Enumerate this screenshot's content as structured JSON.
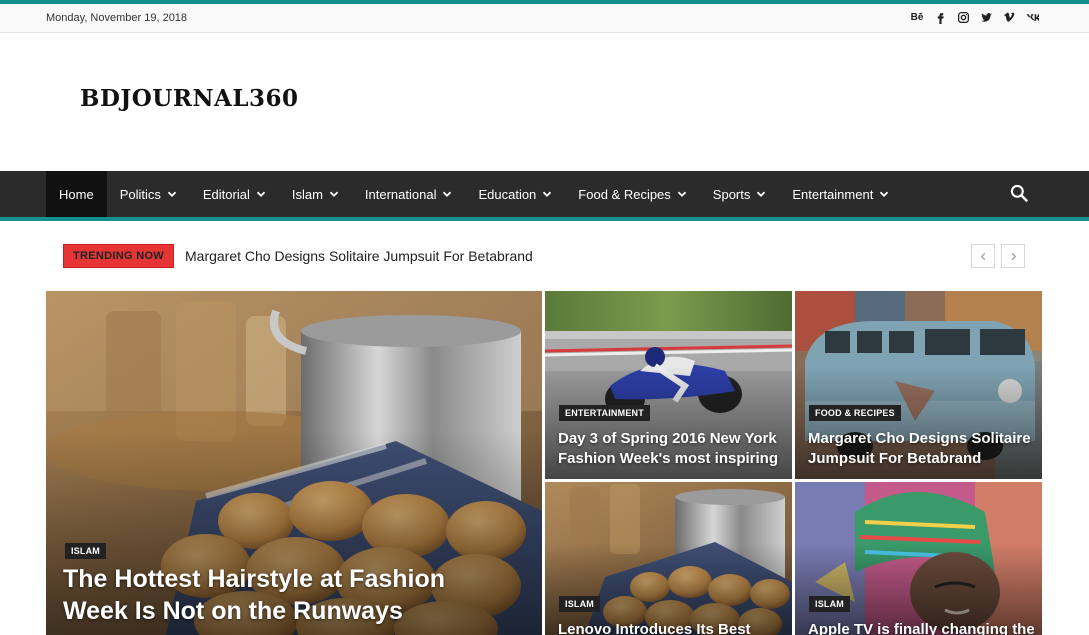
{
  "topbar": {
    "date": "Monday, November 19, 2018",
    "socials": [
      "behance-icon",
      "facebook-icon",
      "instagram-icon",
      "twitter-icon",
      "vimeo-icon",
      "vk-icon"
    ],
    "behance_label": "Bē"
  },
  "header": {
    "logo": "BDJOURNAL360"
  },
  "nav": {
    "items": [
      {
        "label": "Home",
        "dropdown": false,
        "active": true
      },
      {
        "label": "Politics",
        "dropdown": true
      },
      {
        "label": "Editorial",
        "dropdown": true
      },
      {
        "label": "Islam",
        "dropdown": true
      },
      {
        "label": "International",
        "dropdown": true
      },
      {
        "label": "Education",
        "dropdown": true
      },
      {
        "label": "Food & Recipes",
        "dropdown": true
      },
      {
        "label": "Sports",
        "dropdown": true
      },
      {
        "label": "Entertainment",
        "dropdown": true
      }
    ],
    "search_icon": "search-icon"
  },
  "trending": {
    "badge": "TRENDING NOW",
    "title": "Margaret Cho Designs Solitaire Jumpsuit For Betabrand"
  },
  "featured": {
    "big": {
      "category": "ISLAM",
      "title": "The Hottest Hairstyle at Fashion Week Is Not on the Runways"
    },
    "top_middle": {
      "category": "ENTERTAINMENT",
      "title": "Day 3 of Spring 2016 New York Fashion Week's most inspiring"
    },
    "top_right": {
      "category": "FOOD & RECIPES",
      "title": "Margaret Cho Designs Solitaire Jumpsuit For Betabrand"
    },
    "bottom_middle": {
      "category": "ISLAM",
      "title": "Lenovo Introduces Its Best"
    },
    "bottom_right": {
      "category": "ISLAM",
      "title": "Apple TV is finally changing the"
    }
  },
  "colors": {
    "accent": "#14908e",
    "nav_bg": "#2b2b2b",
    "trending_red": "#e63535"
  }
}
